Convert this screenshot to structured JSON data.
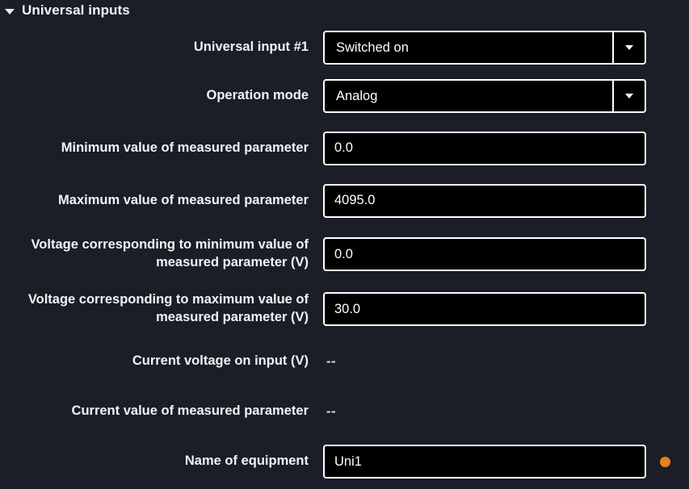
{
  "section": {
    "title": "Universal inputs",
    "expanded": true,
    "caret_icon": "triangle-down-icon"
  },
  "colors": {
    "page_background": "#1b1e26",
    "field_background": "#000000",
    "field_border": "#ffffff",
    "text": "#f2f3f5",
    "status_indicator": "#e8811e"
  },
  "rows": [
    {
      "label": "Universal input #1",
      "type": "select",
      "value": "Switched on",
      "name": "universal-input-1"
    },
    {
      "label": "Operation mode",
      "type": "select",
      "value": "Analog",
      "name": "operation-mode"
    },
    {
      "label": "Minimum value of measured parameter",
      "type": "text",
      "value": "0.0",
      "name": "minimum-value-of-measured-parameter"
    },
    {
      "label": "Maximum value of measured parameter",
      "type": "text",
      "value": "4095.0",
      "name": "maximum-value-of-measured-parameter"
    },
    {
      "label": "Voltage corresponding to minimum value of\nmeasured parameter (V)",
      "type": "text",
      "value": "0.0",
      "name": "voltage-minimum-value"
    },
    {
      "label": "Voltage corresponding to maximum value of\nmeasured parameter (V)",
      "type": "text",
      "value": "30.0",
      "name": "voltage-maximum-value"
    },
    {
      "label": "Current voltage on input (V)",
      "type": "readonly",
      "value": "--",
      "name": "current-voltage-on-input"
    },
    {
      "label": "Current value of measured parameter",
      "type": "readonly",
      "value": "--",
      "name": "current-value-of-measured-parameter"
    },
    {
      "label": "Name of equipment",
      "type": "text",
      "value": "Uni1",
      "name": "name-of-equipment",
      "indicator": true
    }
  ]
}
